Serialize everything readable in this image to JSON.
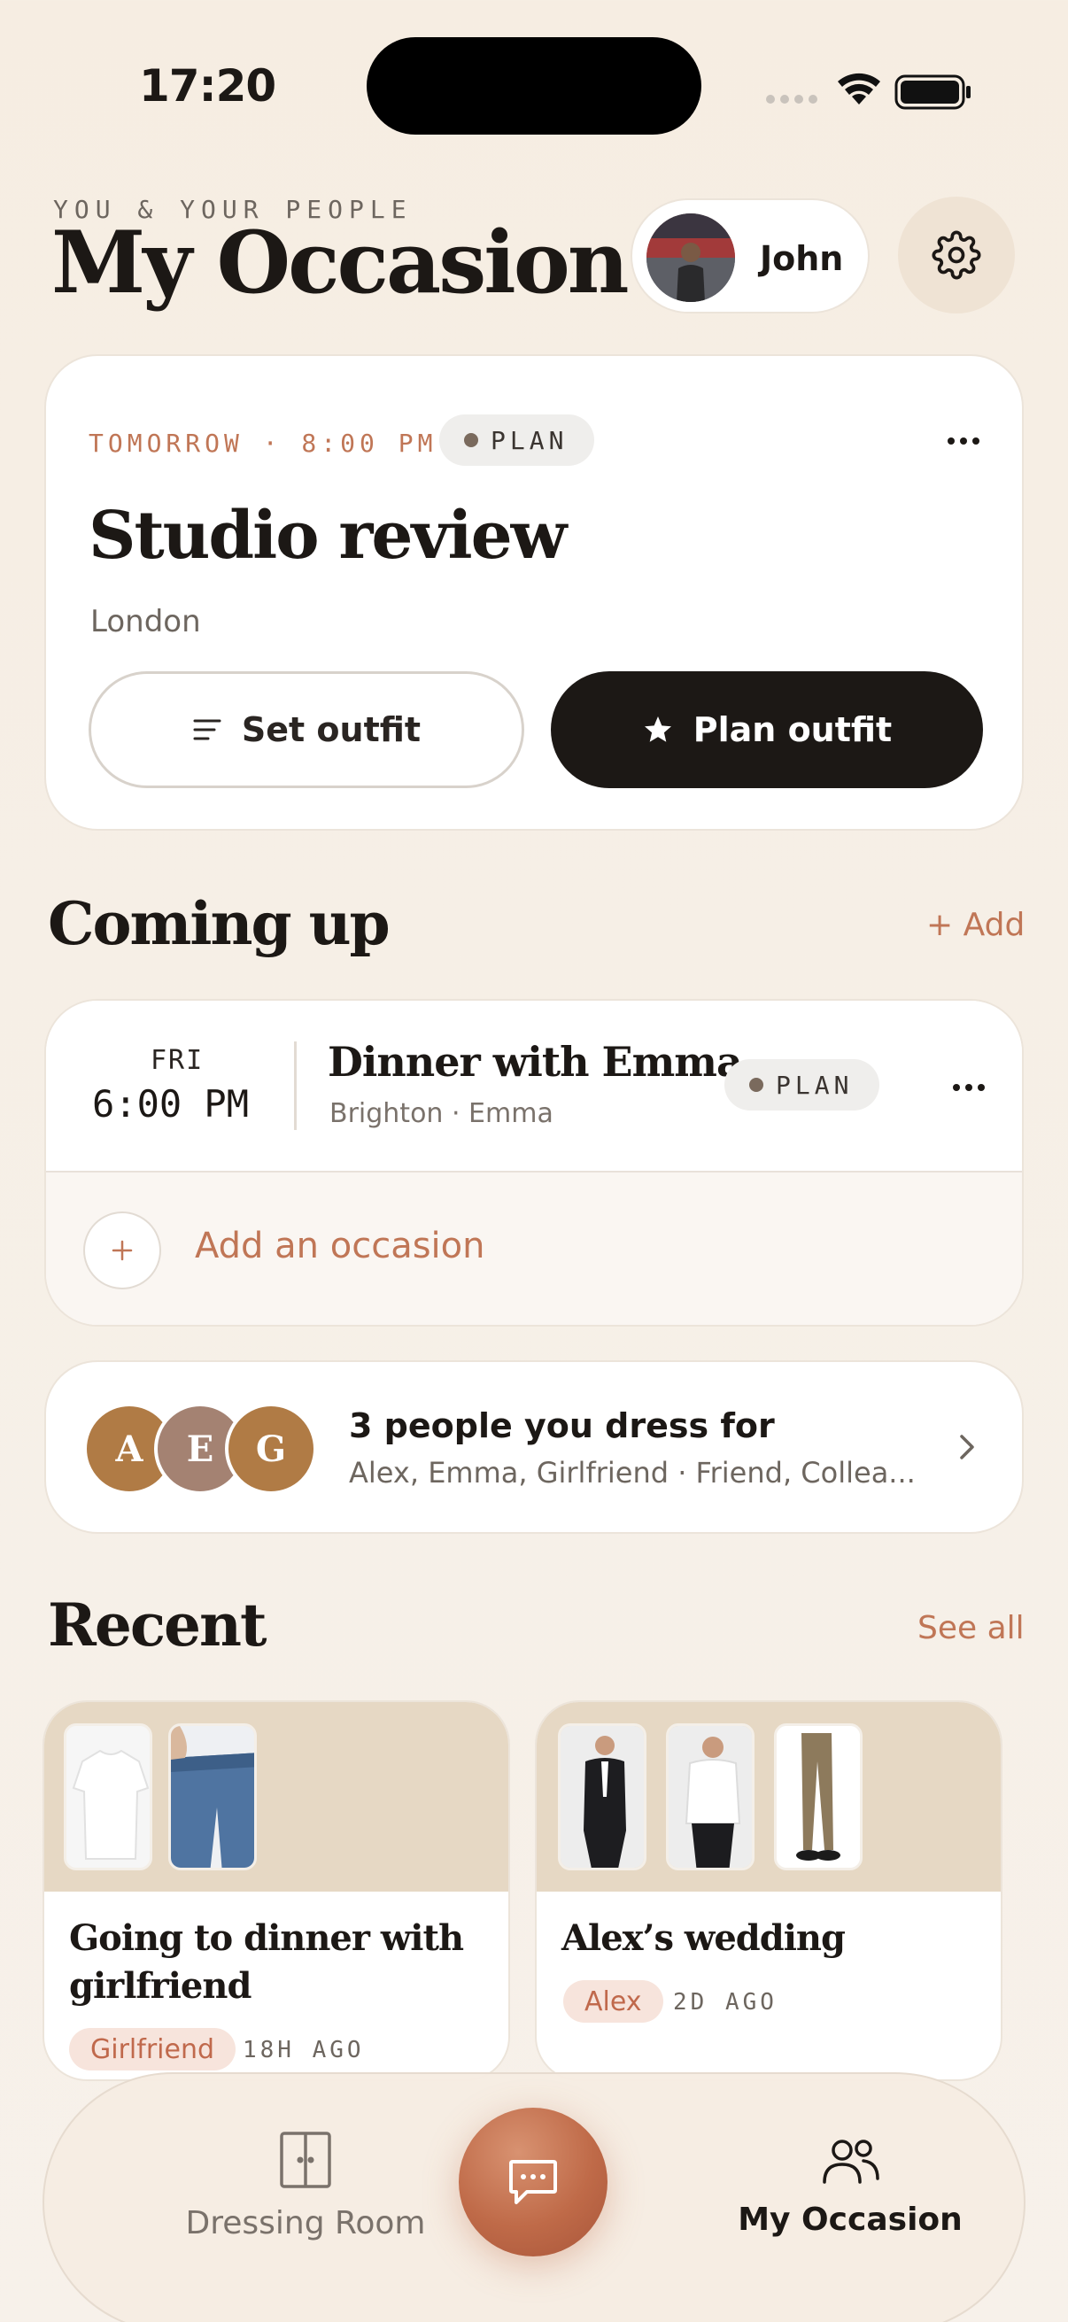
{
  "status_bar": {
    "time": "17:20"
  },
  "header": {
    "eyebrow": "YOU & YOUR PEOPLE",
    "title": "My Occasion",
    "user_name": "John",
    "settings_icon": "gear-icon"
  },
  "featured": {
    "when": "TOMORROW · 8:00 PM",
    "badge": "PLAN",
    "title": "Studio review",
    "location": "London",
    "set_outfit_label": "Set outfit",
    "plan_outfit_label": "Plan outfit"
  },
  "coming_up": {
    "title": "Coming up",
    "add_label": "+ Add",
    "items": [
      {
        "day": "FRI",
        "time": "6:00 PM",
        "title": "Dinner with Emma",
        "meta": "Brighton · Emma",
        "badge": "PLAN"
      }
    ],
    "add_occasion_label": "Add an occasion"
  },
  "people": {
    "avatars": [
      {
        "initial": "A",
        "color": "#b07b45"
      },
      {
        "initial": "E",
        "color": "#a48272"
      },
      {
        "initial": "G",
        "color": "#b07b45"
      }
    ],
    "title": "3 people you dress for",
    "subtitle": "Alex, Emma, Girlfriend · Friend, Collea..."
  },
  "recent": {
    "title": "Recent",
    "see_all_label": "See all",
    "cards": [
      {
        "title": "Going to dinner with girlfriend",
        "chip": "Girlfriend",
        "ago": "18H AGO"
      },
      {
        "title": "Alex’s wedding",
        "chip": "Alex",
        "ago": "2D AGO"
      }
    ]
  },
  "tabbar": {
    "dressing_room_label": "Dressing Room",
    "my_occasion_label": "My Occasion"
  },
  "colors": {
    "accent": "#c07656",
    "dark": "#1c1815",
    "chip_bg": "#f7e4dc"
  }
}
